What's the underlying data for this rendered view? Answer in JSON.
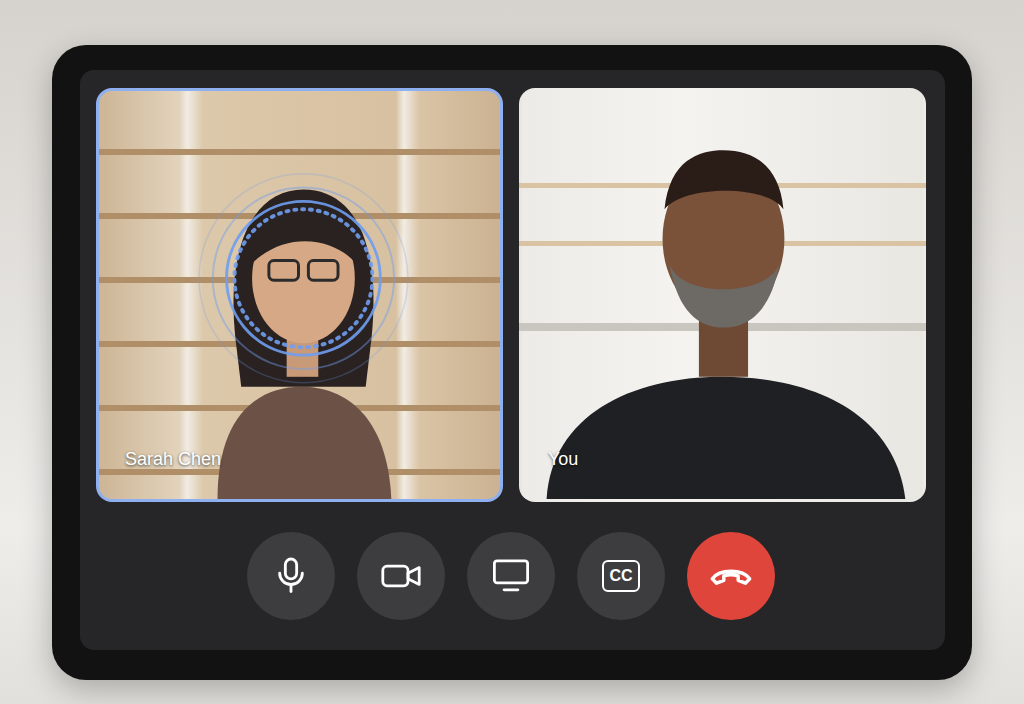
{
  "participants": [
    {
      "name": "Sarah Chen",
      "speaking": true
    },
    {
      "name": "You",
      "speaking": false
    }
  ],
  "controls": [
    {
      "kind": "microphone"
    },
    {
      "kind": "camera"
    },
    {
      "kind": "screen-share"
    },
    {
      "kind": "captions",
      "label": "CC"
    },
    {
      "kind": "end-call"
    }
  ]
}
